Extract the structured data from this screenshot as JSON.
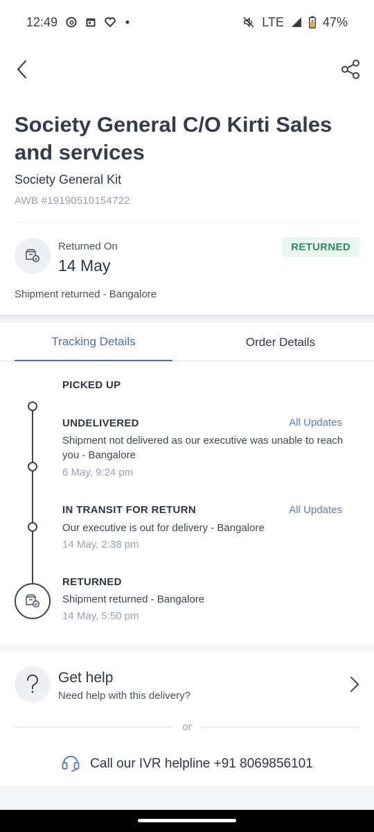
{
  "status_bar": {
    "time": "12:49",
    "network": "LTE",
    "battery": "47%",
    "icons": [
      "threads-icon",
      "calendar-icon",
      "heart-icon",
      "dot-icon",
      "mute-icon",
      "signal-icon",
      "battery-icon"
    ]
  },
  "header": {
    "back_icon": "back-arrow-icon",
    "share_icon": "share-icon"
  },
  "shipment": {
    "title": "Society General C/O Kirti Sales and services",
    "subtitle": "Society General Kit",
    "awb": "AWB #19190510154722"
  },
  "status_card": {
    "label": "Returned On",
    "date": "14 May",
    "badge": "RETURNED",
    "note": "Shipment returned - Bangalore",
    "colors": {
      "badge_bg": "#eaf6ef",
      "badge_text": "#2f8a5c"
    }
  },
  "tabs": [
    {
      "label": "Tracking Details",
      "active": true
    },
    {
      "label": "Order Details",
      "active": false
    }
  ],
  "timeline": {
    "events": [
      {
        "status": "PICKED UP",
        "link": "",
        "description": "",
        "time": ""
      },
      {
        "status": "UNDELIVERED",
        "link": "All Updates",
        "description": "Shipment not delivered as our executive was unable to reach you - Bangalore",
        "time": "6 May, 9:24 pm"
      },
      {
        "status": "IN TRANSIT FOR RETURN",
        "link": "All Updates",
        "description": "Our executive is out for delivery - Bangalore",
        "time": "14 May, 2:38 pm"
      },
      {
        "status": "RETURNED",
        "link": "",
        "description": "Shipment returned - Bangalore",
        "time": "14 May, 5:50 pm"
      }
    ]
  },
  "help": {
    "icon": "question-icon",
    "title": "Get help",
    "subtitle": "Need help with this delivery?",
    "or_text": "or",
    "ivr_text": "Call our IVR helpline +91 8069856101",
    "ivr_icon": "headset-icon"
  },
  "colors": {
    "accent": "#4a6fb5",
    "text_primary": "#2f3542",
    "text_muted": "#9aa0ad"
  }
}
